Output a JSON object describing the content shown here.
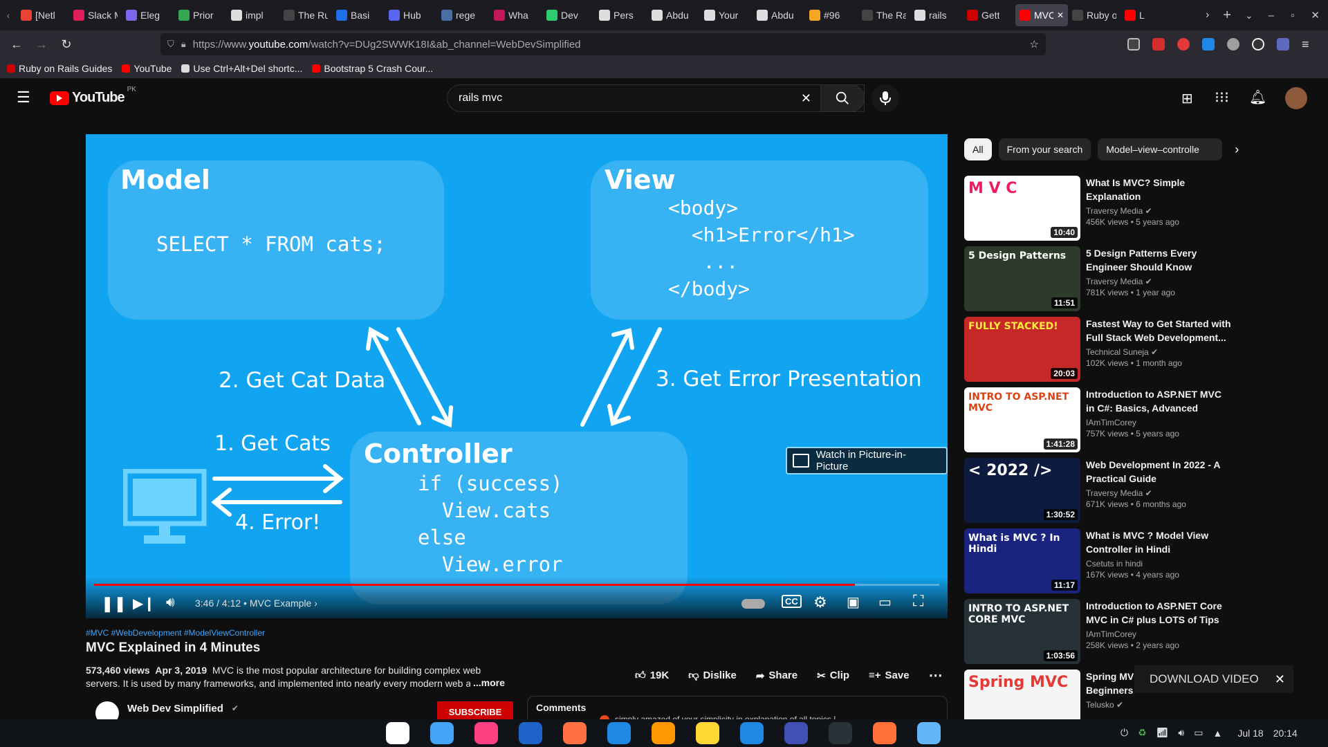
{
  "browser": {
    "tabs": [
      {
        "label": "[Netl",
        "color": "#ea4335",
        "icon": "gmail-icon"
      },
      {
        "label": "Slack MUTE",
        "color": "#e01e5a",
        "icon": "slack-icon"
      },
      {
        "label": "Eleg",
        "color": "#7b68ee",
        "icon": "elegant-icon"
      },
      {
        "label": "Prior",
        "color": "#34a853",
        "icon": "priority-icon"
      },
      {
        "label": "impl",
        "color": "#dddddd",
        "icon": "github-icon"
      },
      {
        "label": "The Rub",
        "color": "#444444",
        "icon": "page-icon"
      },
      {
        "label": "Basi",
        "color": "#1f6feb",
        "icon": "triangle-icon"
      },
      {
        "label": "Hub",
        "color": "#5865f2",
        "icon": "hub-icon"
      },
      {
        "label": "rege",
        "color": "#4a6fa5",
        "icon": "regex-icon"
      },
      {
        "label": "Wha",
        "color": "#c2185b",
        "icon": "heart-icon"
      },
      {
        "label": "Dev",
        "color": "#2ecc71",
        "icon": "devs-icon"
      },
      {
        "label": "Pers",
        "color": "#dddddd",
        "icon": "github-icon"
      },
      {
        "label": "Abdu",
        "color": "#dddddd",
        "icon": "github-icon"
      },
      {
        "label": "Your",
        "color": "#dddddd",
        "icon": "github-icon"
      },
      {
        "label": "Abdu",
        "color": "#dddddd",
        "icon": "github-icon"
      },
      {
        "label": "#96",
        "color": "#f5a623",
        "icon": "terminal-icon"
      },
      {
        "label": "The Rail",
        "color": "#444444",
        "icon": "page-icon"
      },
      {
        "label": "rails",
        "color": "#dddddd",
        "icon": "github-icon"
      },
      {
        "label": "Gett",
        "color": "#cc0000",
        "icon": "rails-icon"
      },
      {
        "label": "MVC PL",
        "color": "#ff0000",
        "icon": "youtube-icon",
        "active": true
      },
      {
        "label": "Ruby on",
        "color": "#444444",
        "icon": "page-icon"
      },
      {
        "label": "L",
        "color": "#ff0000",
        "icon": "youtube-icon"
      }
    ],
    "url_prefix": "https://www.",
    "url_host": "youtube.com",
    "url_path": "/watch?v=DUg2SWWK18I&ab_channel=WebDevSimplified",
    "bookmarks": [
      {
        "label": "Ruby on Rails Guides",
        "color": "#cc0000",
        "icon": "rails-icon"
      },
      {
        "label": "YouTube",
        "color": "#ff0000",
        "icon": "youtube-icon"
      },
      {
        "label": "Use Ctrl+Alt+Del shortc...",
        "color": "#dddddd",
        "icon": "page-icon"
      },
      {
        "label": "Bootstrap 5 Crash Cour...",
        "color": "#ff0000",
        "icon": "youtube-icon"
      }
    ]
  },
  "yt": {
    "logo": "YouTube",
    "country": "PK",
    "search_value": "rails mvc"
  },
  "video": {
    "diagram": {
      "model_title": "Model",
      "model_code": "SELECT * FROM cats;",
      "view_title": "View",
      "view_code": [
        "<body>",
        "  <h1>Error</h1>",
        "   ...",
        "</body>"
      ],
      "controller_title": "Controller",
      "controller_code": [
        "if (success)",
        "  View.cats",
        "else",
        "  View.error"
      ],
      "label_get_cat_data": "2. Get Cat Data",
      "label_get_error": "3. Get Error Presentation",
      "label_get_cats": "1. Get Cats",
      "label_error": "4. Error!"
    },
    "pip_label": "Watch in Picture-in-Picture",
    "time": "3:46 / 4:12",
    "chapter": "MVC Example",
    "progress": 0.9,
    "hashtags": "#MVC #WebDevelopment #ModelViewController",
    "title": "MVC Explained in 4 Minutes",
    "views": "573,460 views",
    "date": "Apr 3, 2019",
    "description": "MVC is the most popular architecture for building complex web servers. It is used by many frameworks, and implemented into nearly every modern web a",
    "more": "...more",
    "likes": "19K",
    "dislike": "Dislike",
    "share": "Share",
    "clip": "Clip",
    "save": "Save",
    "channel": "Web Dev Simplified",
    "subscribe": "SUBSCRIBE",
    "comments_label": "Comments",
    "comment_preview": "simply amazed of your simplicity in explanation of all topics !"
  },
  "chips": [
    "All",
    "From your search",
    "Model–view–controlle"
  ],
  "recs": [
    {
      "title": "What Is MVC? Simple Explanation",
      "channel": "Traversy Media",
      "verified": true,
      "meta": "456K views • 5 years ago",
      "duration": "10:40",
      "thumb_bg": "#ffffff",
      "thumb_text": "M V C",
      "thumb_fg": "#e91e63"
    },
    {
      "title": "5 Design Patterns Every Engineer Should Know",
      "channel": "Traversy Media",
      "verified": true,
      "meta": "781K views • 1 year ago",
      "duration": "11:51",
      "thumb_bg": "#2d3b2a",
      "thumb_text": "5 Design Patterns",
      "thumb_fg": "#ffffff"
    },
    {
      "title": "Fastest Way to Get Started with Full Stack Web Development...",
      "channel": "Technical Suneja",
      "verified": true,
      "meta": "102K views • 1 month ago",
      "duration": "20:03",
      "thumb_bg": "#c62828",
      "thumb_text": "FULLY STACKED!",
      "thumb_fg": "#ffeb3b"
    },
    {
      "title": "Introduction to ASP.NET MVC in C#: Basics, Advanced Topics,...",
      "channel": "IAmTimCorey",
      "verified": false,
      "meta": "757K views • 5 years ago",
      "duration": "1:41:28",
      "thumb_bg": "#ffffff",
      "thumb_text": "INTRO TO ASP.NET MVC",
      "thumb_fg": "#d84315"
    },
    {
      "title": "Web Development In 2022 - A Practical Guide",
      "channel": "Traversy Media",
      "verified": true,
      "meta": "671K views • 6 months ago",
      "duration": "1:30:52",
      "thumb_bg": "#0d1b3e",
      "thumb_text": "< 2022 />",
      "thumb_fg": "#ffffff"
    },
    {
      "title": "What is MVC ? Model View Controller in Hindi",
      "channel": "Csetuts in hindi",
      "verified": false,
      "meta": "167K views • 4 years ago",
      "duration": "11:17",
      "thumb_bg": "#1a237e",
      "thumb_text": "What is MVC ? In Hindi",
      "thumb_fg": "#ffffff"
    },
    {
      "title": "Introduction to ASP.NET Core MVC in C# plus LOTS of Tips",
      "channel": "IAmTimCorey",
      "verified": false,
      "meta": "258K views • 2 years ago",
      "duration": "1:03:56",
      "thumb_bg": "#263238",
      "thumb_text": "INTRO TO ASP.NET CORE MVC",
      "thumb_fg": "#ffffff"
    },
    {
      "title": "Spring MVC Tutorial for Beginners",
      "channel": "Telusko",
      "verified": true,
      "meta": "",
      "duration": "",
      "thumb_bg": "#f5f5f5",
      "thumb_text": "Spring MVC",
      "thumb_fg": "#e53935"
    }
  ],
  "download_label": "DOWNLOAD VIDEO",
  "taskbar": {
    "date": "Jul 18",
    "time": "20:14",
    "apps": [
      {
        "name": "taskview-icon",
        "color": "#ffffff"
      },
      {
        "name": "mail-icon",
        "color": "#42a5f5"
      },
      {
        "name": "music-icon",
        "color": "#ff4081"
      },
      {
        "name": "word-icon",
        "color": "#1e63c9"
      },
      {
        "name": "store-icon",
        "color": "#ff7043"
      },
      {
        "name": "help-icon",
        "color": "#1e88e5"
      },
      {
        "name": "vlc-icon",
        "color": "#ff9800"
      },
      {
        "name": "files-icon",
        "color": "#fdd835"
      },
      {
        "name": "vscode-icon",
        "color": "#1e88e5"
      },
      {
        "name": "network-icon",
        "color": "#3f51b5"
      },
      {
        "name": "terminal-icon",
        "color": "#263238"
      },
      {
        "name": "firefox-icon",
        "color": "#ff7139"
      },
      {
        "name": "installer-icon",
        "color": "#64b5f6"
      }
    ]
  }
}
